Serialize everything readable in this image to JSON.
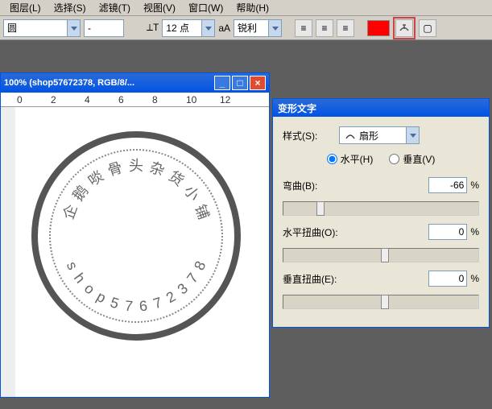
{
  "menu": {
    "items": [
      "图层(L)",
      "选择(S)",
      "滤镜(T)",
      "视图(V)",
      "窗口(W)",
      "帮助(H)"
    ]
  },
  "toolbar": {
    "font_preview": "圆",
    "font_size": "12 点",
    "aa_label": "aA",
    "aa_mode": "锐利",
    "color": "#ff0000"
  },
  "doc": {
    "title": "100% (shop57672378, RGB/8/...",
    "ruler_ticks": [
      "0",
      "2",
      "4",
      "6",
      "8",
      "10",
      "12"
    ],
    "stamp_top_text": "企鹅啖骨头杂货小铺",
    "stamp_bottom_text": "shop57672378"
  },
  "panel": {
    "title": "变形文字",
    "style_label": "样式(S):",
    "style_value": "扇形",
    "horiz_label": "水平(H)",
    "vert_label": "垂直(V)",
    "bend": {
      "label": "弯曲(B):",
      "value": "-66",
      "pos": 17
    },
    "hdist": {
      "label": "水平扭曲(O):",
      "value": "0",
      "pos": 50
    },
    "vdist": {
      "label": "垂直扭曲(E):",
      "value": "0",
      "pos": 50
    },
    "pct": "%"
  }
}
